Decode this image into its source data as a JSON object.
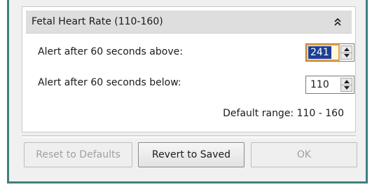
{
  "panel": {
    "title": "Fetal Heart Rate (110-160)",
    "collapse_icon": "double-chevron-up-icon"
  },
  "alerts": {
    "above_label": "Alert after 60 seconds above:",
    "above_value": "241",
    "below_label": "Alert after 60 seconds below:",
    "below_value": "110"
  },
  "default_range": "Default range: 110 - 160",
  "buttons": {
    "reset": "Reset to Defaults",
    "revert": "Revert to Saved",
    "ok": "OK"
  },
  "colors": {
    "window_border": "#3f8080",
    "selection": "#1c3f94",
    "focus_highlight": "#e8a040"
  }
}
